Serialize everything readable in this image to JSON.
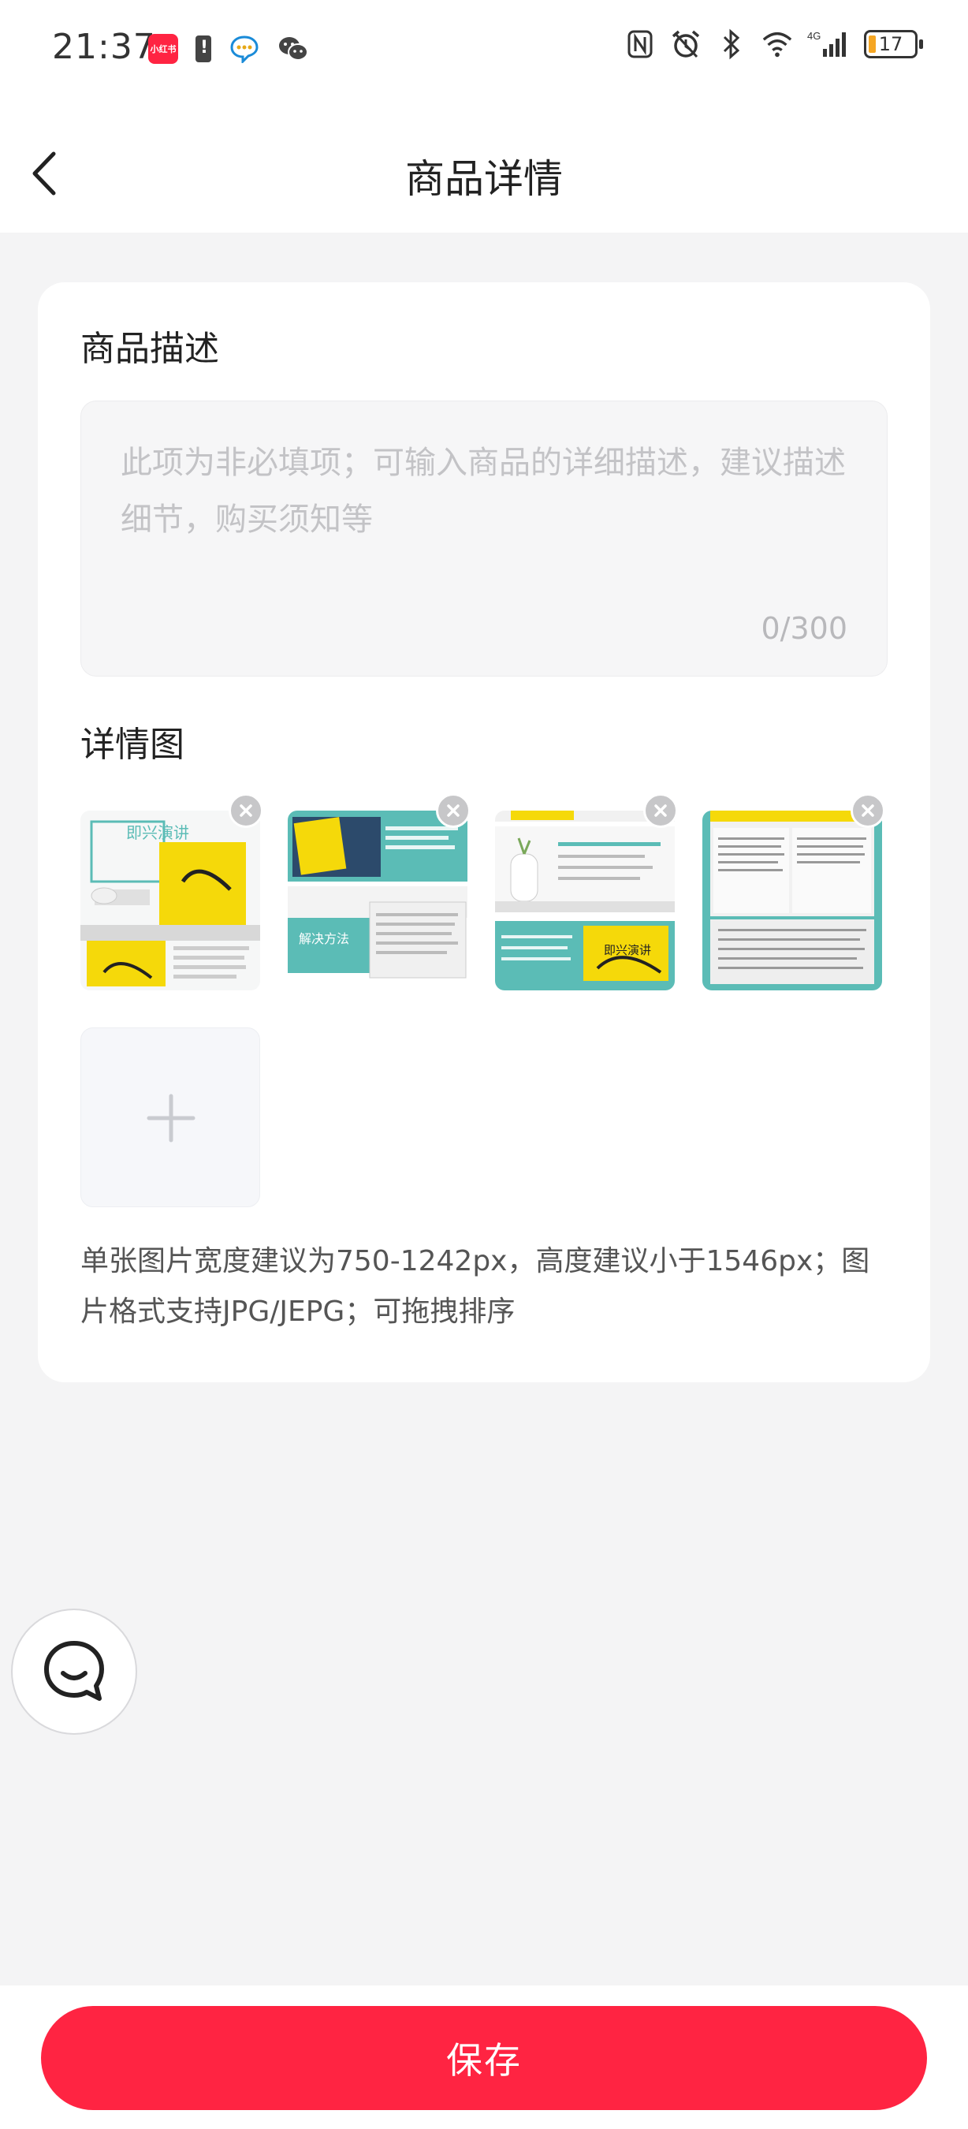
{
  "status_bar": {
    "time": "21:37",
    "app_badge": "小红书",
    "battery_level": "17",
    "network": "4G",
    "icons": [
      "app-notification-icon",
      "battery-alert-icon",
      "chat-bubble-icon",
      "wechat-icon",
      "nfc-icon",
      "alarm-icon",
      "bluetooth-icon",
      "wifi-icon",
      "signal-icon",
      "battery-icon"
    ]
  },
  "nav": {
    "title": "商品详情",
    "back_icon": "chevron-left-icon"
  },
  "description": {
    "title": "商品描述",
    "value": "",
    "placeholder": "此项为非必填项；可输入商品的详细描述，建议描述细节，购买须知等",
    "counter": "0/300"
  },
  "detail_images": {
    "title": "详情图",
    "images": [
      {
        "name": "detail-image-1",
        "caption": "即兴演讲"
      },
      {
        "name": "detail-image-2",
        "caption": "解决方法"
      },
      {
        "name": "detail-image-3",
        "caption": "即兴演讲"
      },
      {
        "name": "detail-image-4",
        "caption": ""
      }
    ],
    "add_icon": "plus-icon",
    "remove_icon": "close-icon",
    "hint": "单张图片宽度建议为750-1242px，高度建议小于1546px；图片格式支持JPG/JEPG；可拖拽排序"
  },
  "chat": {
    "icon": "chat-icon"
  },
  "footer": {
    "save_label": "保存"
  },
  "colors": {
    "accent": "#ff2442",
    "background": "#f4f4f5",
    "card": "#ffffff",
    "placeholder": "#c3c3c6",
    "book_yellow": "#f5d90a",
    "teal": "#5bbcb6"
  }
}
